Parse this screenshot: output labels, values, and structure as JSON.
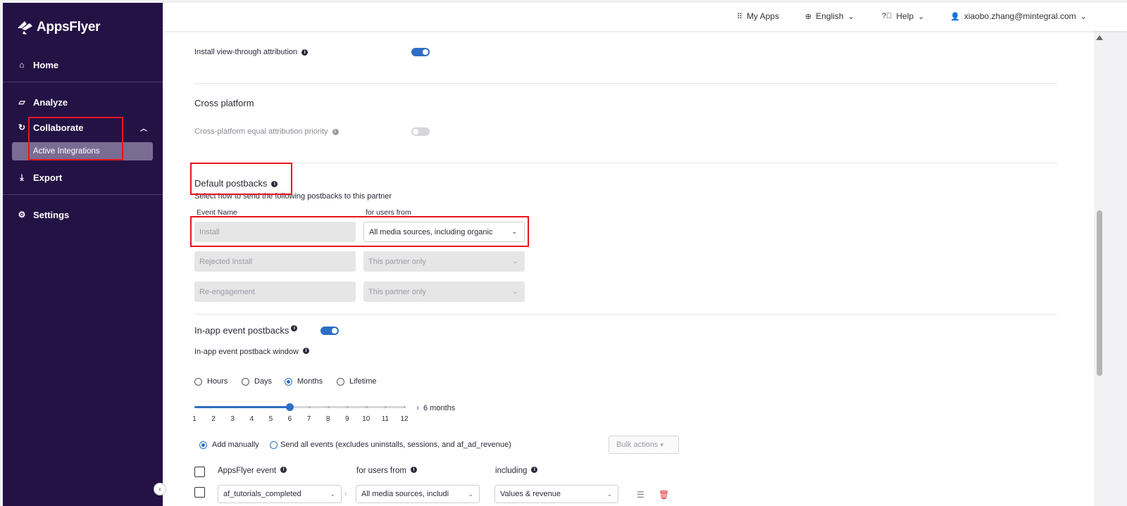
{
  "brand": {
    "name": "AppsFlyer"
  },
  "sidebar": {
    "items": [
      {
        "label": "Home",
        "icon": "home-icon"
      },
      {
        "label": "Analyze",
        "icon": "chart-icon"
      },
      {
        "label": "Collaborate",
        "icon": "sync-icon"
      },
      {
        "label": "Export",
        "icon": "download-icon"
      },
      {
        "label": "Settings",
        "icon": "gear-icon"
      }
    ],
    "sub_item": "Active Integrations"
  },
  "topbar": {
    "my_apps": "My Apps",
    "language": "English",
    "help": "Help",
    "user": "xiaobo.zhang@mintegral.com"
  },
  "attribution": {
    "view_through_label": "Install view-through attribution",
    "view_through_on": true
  },
  "cross_platform": {
    "title": "Cross platform",
    "equal_priority_label": "Cross-platform equal attribution priority",
    "equal_priority_on": false
  },
  "default_postbacks": {
    "title": "Default postbacks",
    "description": "Select how to send the following postbacks to this partner",
    "col_event": "Event Name",
    "col_users": "for users from",
    "rows": [
      {
        "event": "Install",
        "users": "All media sources, including organic",
        "enabled": true
      },
      {
        "event": "Rejected Install",
        "users": "This partner only",
        "enabled": false
      },
      {
        "event": "Re-engagement",
        "users": "This partner only",
        "enabled": false
      }
    ]
  },
  "inapp": {
    "title": "In-app event postbacks",
    "enabled": true,
    "window_label": "In-app event postback window",
    "window_options": [
      "Hours",
      "Days",
      "Months",
      "Lifetime"
    ],
    "window_selected": "Months",
    "slider_value": 6,
    "slider_max": 12,
    "slider_ticks": [
      "1",
      "2",
      "3",
      "4",
      "5",
      "6",
      "7",
      "8",
      "9",
      "10",
      "11",
      "12"
    ],
    "slider_readout": "6 months",
    "mode_manual": "Add manually",
    "mode_all": "Send all events (excludes uninstalls, sessions, and af_ad_revenue)",
    "bulk_actions": "Bulk actions",
    "table_headers": {
      "event": "AppsFlyer event",
      "users": "for users from",
      "including": "including"
    },
    "first_row": {
      "event": "af_tutorials_completed",
      "users": "All media sources, includi",
      "including": "Values & revenue"
    }
  },
  "colors": {
    "sidebar": "#241245",
    "accent": "#2f6ec5",
    "highlight": "#e8141c"
  }
}
